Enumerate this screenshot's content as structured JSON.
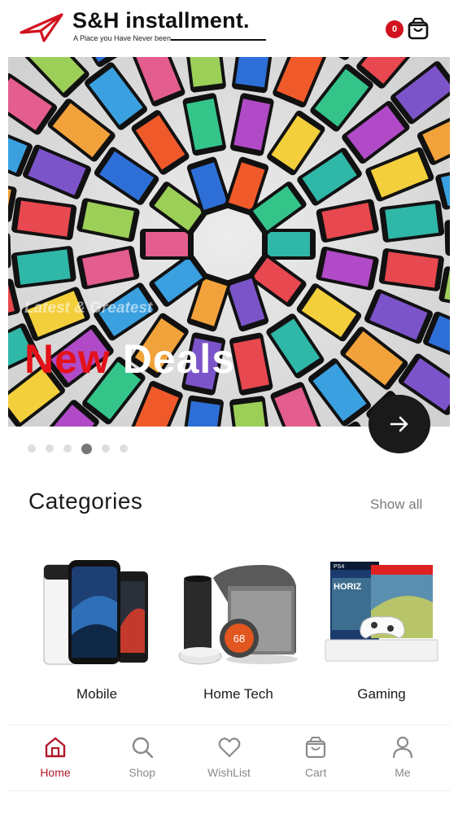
{
  "header": {
    "brand": "S&H installment.",
    "tagline": "A Place you Have Never been",
    "cart_count": "0"
  },
  "banner": {
    "subtitle": "Latest & Greatest",
    "title_red": "New",
    "title_white": " Deals",
    "slides_total": 6,
    "active_slide": 4
  },
  "categories": {
    "title": "Categories",
    "show_all": "Show all",
    "items": [
      {
        "label": "Mobile"
      },
      {
        "label": "Home Tech",
        "thermostat_reading": "68"
      },
      {
        "label": "Gaming",
        "box_text": "PS4",
        "box_brand": "HORIZ"
      }
    ]
  },
  "tabbar": {
    "items": [
      {
        "label": "Home",
        "icon": "home-icon"
      },
      {
        "label": "Shop",
        "icon": "search-icon"
      },
      {
        "label": "WishList",
        "icon": "heart-icon"
      },
      {
        "label": "Cart",
        "icon": "cart-icon"
      },
      {
        "label": "Me",
        "icon": "user-icon"
      }
    ]
  },
  "colors": {
    "accent": "#b0182b",
    "badge": "#d2121f",
    "deal_red": "#e3121a"
  }
}
